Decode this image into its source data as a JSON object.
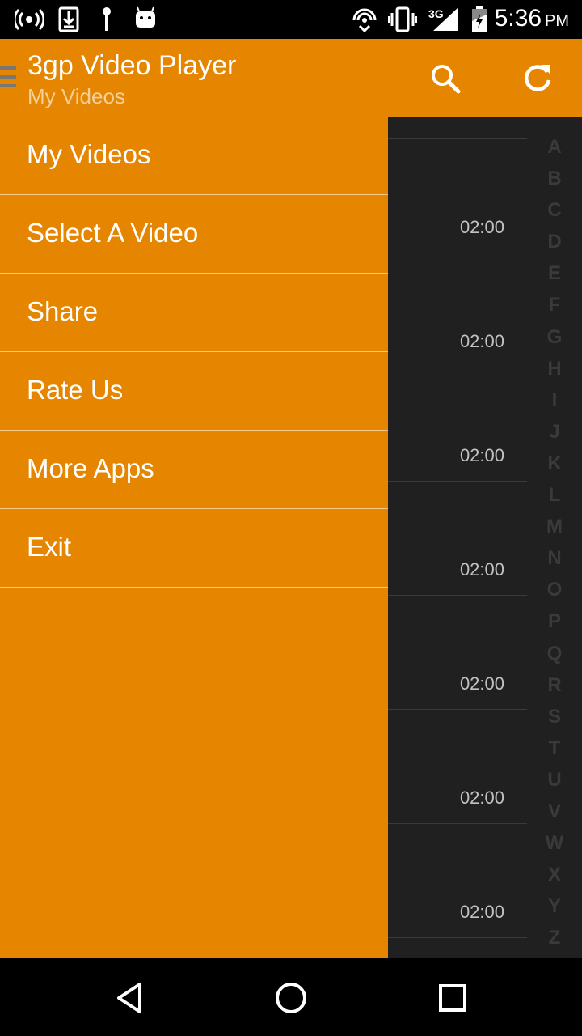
{
  "status_bar": {
    "time": "5:36",
    "ampm": "PM",
    "network": "3G",
    "icons": [
      "hotspot-icon",
      "download-icon",
      "microphone-icon",
      "android-icon",
      "cast-icon",
      "vibrate-icon",
      "signal-icon",
      "battery-icon"
    ]
  },
  "app_bar": {
    "title": "3gp Video Player",
    "subtitle": "My Videos",
    "icons": [
      "menu-icon",
      "search-icon",
      "refresh-icon"
    ]
  },
  "drawer": {
    "items": [
      {
        "label": "My Videos"
      },
      {
        "label": "Select A Video"
      },
      {
        "label": "Share"
      },
      {
        "label": "Rate Us"
      },
      {
        "label": "More Apps"
      },
      {
        "label": "Exit"
      }
    ]
  },
  "video_list": {
    "durations": [
      "02:00",
      "02:00",
      "02:00",
      "02:00",
      "02:00",
      "02:00",
      "02:00"
    ]
  },
  "alpha_index": [
    "A",
    "B",
    "C",
    "D",
    "E",
    "F",
    "G",
    "H",
    "I",
    "J",
    "K",
    "L",
    "M",
    "N",
    "O",
    "P",
    "Q",
    "R",
    "S",
    "T",
    "U",
    "V",
    "W",
    "X",
    "Y",
    "Z"
  ],
  "navigation_bar": {
    "icons": [
      "back-icon",
      "home-icon",
      "recents-icon"
    ]
  },
  "colors": {
    "accent": "#e58500",
    "background": "#202020",
    "subtitle": "#f1d09b"
  }
}
